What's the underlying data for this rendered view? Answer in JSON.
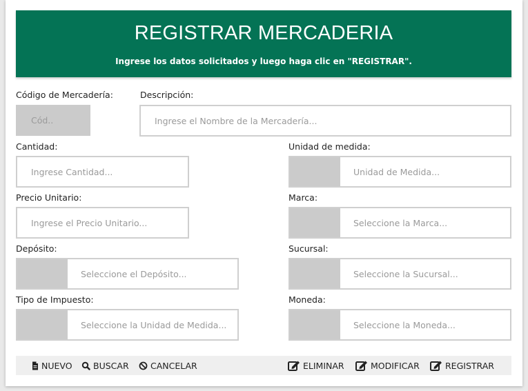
{
  "header": {
    "title": "REGISTRAR MERCADERIA",
    "subtitle": "Ingrese los datos solicitados y luego haga clic en \"REGISTRAR\"."
  },
  "form": {
    "codigo": {
      "label": "Código de Mercadería:",
      "placeholder": "Cód.."
    },
    "descripcion": {
      "label": "Descripción:",
      "placeholder": "Ingrese el Nombre de la Mercadería..."
    },
    "cantidad": {
      "label": "Cantidad:",
      "placeholder": "Ingrese Cantidad..."
    },
    "unidad": {
      "label": "Unidad de medida:",
      "placeholder": "Unidad de Medida..."
    },
    "precio": {
      "label": "Precio Unitario:",
      "placeholder": "Ingrese el Precio Unitario..."
    },
    "marca": {
      "label": "Marca:",
      "placeholder": "Seleccione la Marca..."
    },
    "deposito": {
      "label": "Depósito:",
      "placeholder": "Seleccione el Depósito..."
    },
    "sucursal": {
      "label": "Sucursal:",
      "placeholder": "Seleccione la Sucursal..."
    },
    "impuesto": {
      "label": "Tipo de Impuesto:",
      "placeholder": "Seleccione la Unidad de Medida..."
    },
    "moneda": {
      "label": "Moneda:",
      "placeholder": "Seleccione la Moneda..."
    }
  },
  "toolbar": {
    "nuevo": "NUEVO",
    "buscar": "BUSCAR",
    "cancelar": "CANCELAR",
    "eliminar": "ELIMINAR",
    "modificar": "MODIFICAR",
    "registrar": "REGISTRAR"
  },
  "icons": {
    "nuevo": "file-icon",
    "buscar": "search-icon",
    "cancelar": "ban-icon",
    "edit": "edit-icon"
  },
  "colors": {
    "header_bg": "#047355",
    "addon_gray": "#cbcbcb",
    "toolbar_bg": "#efefef"
  }
}
